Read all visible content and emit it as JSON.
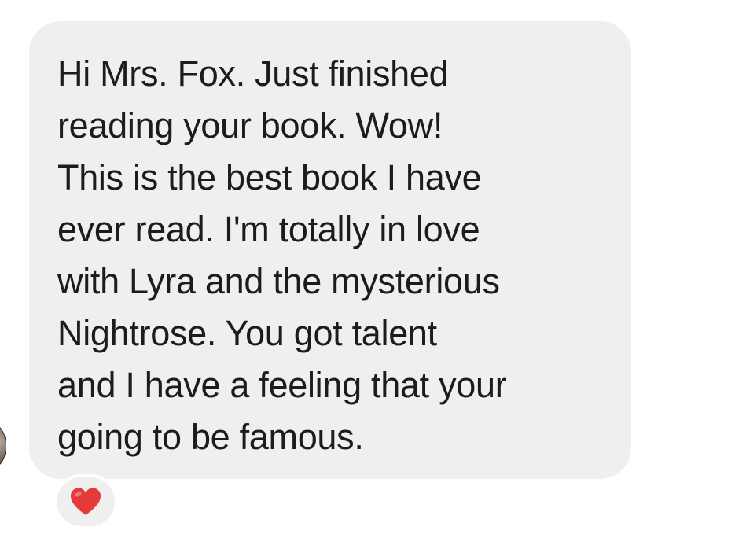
{
  "message": {
    "text": "Hi Mrs. Fox. Just finished\nreading your book. Wow!\nThis is the best book I have\never read. I'm totally in love\nwith Lyra and the mysterious\nNightrose. You got talent\nand I have a feeling that your\ngoing to be famous."
  },
  "reaction": {
    "icon": "red-heart-icon",
    "color": "#e53a3a"
  },
  "colors": {
    "bubble": "#efeff0",
    "text": "#1c1c1c",
    "background": "#ffffff"
  }
}
